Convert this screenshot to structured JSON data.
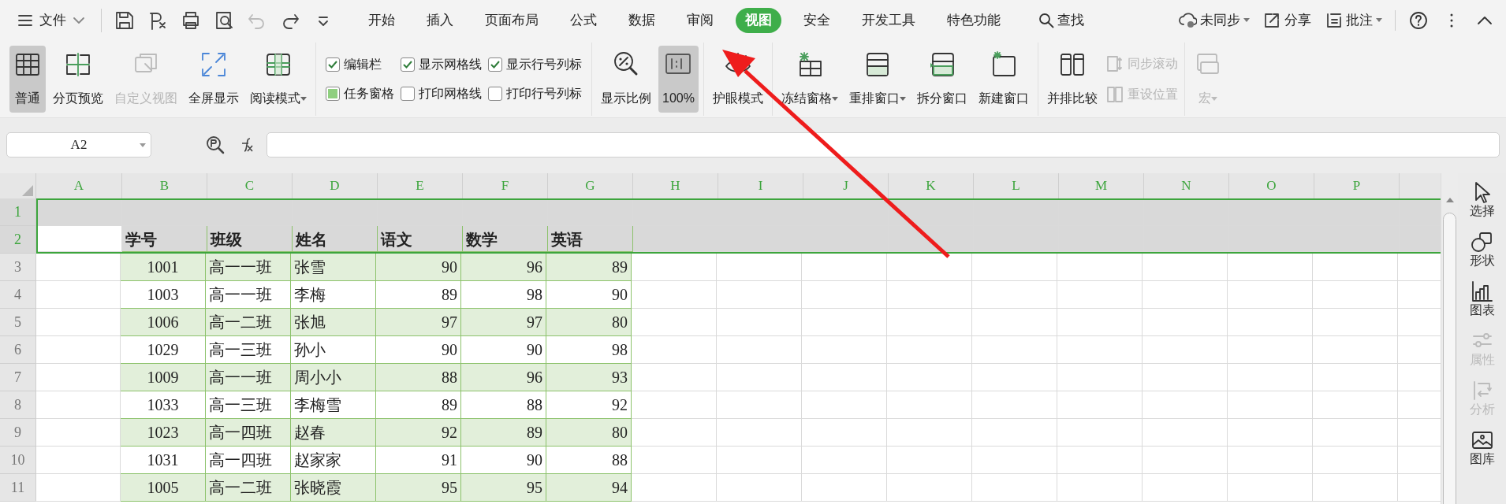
{
  "title_bar": {
    "file_menu": "文件",
    "tabs": [
      {
        "label": "开始",
        "selected": false
      },
      {
        "label": "插入",
        "selected": false
      },
      {
        "label": "页面布局",
        "selected": false
      },
      {
        "label": "公式",
        "selected": false
      },
      {
        "label": "数据",
        "selected": false
      },
      {
        "label": "审阅",
        "selected": false
      },
      {
        "label": "视图",
        "selected": true
      },
      {
        "label": "安全",
        "selected": false
      },
      {
        "label": "开发工具",
        "selected": false
      },
      {
        "label": "特色功能",
        "selected": false
      }
    ],
    "search": "查找",
    "actions": [
      {
        "label": "未同步",
        "dropdown": true
      },
      {
        "label": "分享"
      },
      {
        "label": "批注",
        "dropdown": true
      }
    ]
  },
  "ribbon": {
    "groups": [
      {
        "items": [
          {
            "kind": "large",
            "label": "普通",
            "selected": true,
            "disabled": false
          },
          {
            "kind": "large",
            "label": "分页预览",
            "selected": false,
            "disabled": false
          },
          {
            "kind": "large",
            "label": "自定义视图",
            "selected": false,
            "disabled": true
          },
          {
            "kind": "large",
            "label": "全屏显示",
            "selected": false,
            "disabled": false
          },
          {
            "kind": "large",
            "label": "阅读模式",
            "selected": false,
            "disabled": false,
            "dropdown": true
          }
        ]
      },
      {
        "items": [
          {
            "kind": "check",
            "label": "编辑栏",
            "checked": true
          },
          {
            "kind": "square_check",
            "label": "任务窗格",
            "checked": true
          },
          {
            "kind": "check",
            "label": "显示网格线",
            "checked": true
          },
          {
            "kind": "check",
            "label": "打印网格线",
            "checked": false
          },
          {
            "kind": "check",
            "label": "显示行号列标",
            "checked": true
          },
          {
            "kind": "check",
            "label": "打印行号列标",
            "checked": false
          }
        ]
      },
      {
        "items": [
          {
            "kind": "large",
            "label": "显示比例",
            "selected": false,
            "disabled": false
          },
          {
            "kind": "large",
            "label": "100%",
            "selected": true,
            "disabled": false
          }
        ]
      },
      {
        "items": [
          {
            "kind": "large",
            "label": "护眼模式",
            "selected": false,
            "disabled": false
          }
        ]
      },
      {
        "items": [
          {
            "kind": "large",
            "label": "冻结窗格",
            "selected": false,
            "disabled": false,
            "dropdown": true
          },
          {
            "kind": "large",
            "label": "重排窗口",
            "selected": false,
            "disabled": false,
            "dropdown": true
          },
          {
            "kind": "large",
            "label": "拆分窗口",
            "selected": false,
            "disabled": false
          },
          {
            "kind": "large",
            "label": "新建窗口",
            "selected": false,
            "disabled": false
          }
        ]
      },
      {
        "items": [
          {
            "kind": "large",
            "label": "并排比较",
            "selected": false,
            "disabled": false
          },
          {
            "kind": "small",
            "label": "同步滚动",
            "disabled": true
          },
          {
            "kind": "small",
            "label": "重设位置",
            "disabled": true
          }
        ]
      },
      {
        "items": [
          {
            "kind": "large",
            "label": "宏",
            "selected": false,
            "disabled": true,
            "dropdown": true
          }
        ]
      }
    ]
  },
  "formula_bar": {
    "name_box": "A2"
  },
  "sheet": {
    "columns": [
      {
        "label": "A",
        "selected": true
      },
      {
        "label": "B",
        "selected": true
      },
      {
        "label": "C",
        "selected": true
      },
      {
        "label": "D",
        "selected": true
      },
      {
        "label": "E",
        "selected": true
      },
      {
        "label": "F",
        "selected": true
      },
      {
        "label": "G",
        "selected": true
      },
      {
        "label": "H",
        "selected": true
      },
      {
        "label": "I",
        "selected": true
      },
      {
        "label": "J",
        "selected": true
      },
      {
        "label": "K",
        "selected": true
      },
      {
        "label": "L",
        "selected": true
      },
      {
        "label": "M",
        "selected": true
      },
      {
        "label": "N",
        "selected": true
      },
      {
        "label": "O",
        "selected": true
      },
      {
        "label": "P",
        "selected": true
      }
    ],
    "rows": [
      {
        "number": "1",
        "selected": true,
        "kind": "blank"
      },
      {
        "number": "2",
        "selected": true,
        "active": true,
        "kind": "header",
        "cells": [
          "学号",
          "班级",
          "姓名",
          "语文",
          "数学",
          "英语"
        ]
      },
      {
        "number": "3",
        "selected": false,
        "shaded": true,
        "kind": "data",
        "cells": [
          "1001",
          "高一一班",
          "张雪",
          "90",
          "96",
          "89"
        ]
      },
      {
        "number": "4",
        "selected": false,
        "shaded": false,
        "kind": "data",
        "cells": [
          "1003",
          "高一一班",
          "李梅",
          "89",
          "98",
          "90"
        ]
      },
      {
        "number": "5",
        "selected": false,
        "shaded": true,
        "kind": "data",
        "cells": [
          "1006",
          "高一二班",
          "张旭",
          "97",
          "97",
          "80"
        ]
      },
      {
        "number": "6",
        "selected": false,
        "shaded": false,
        "kind": "data",
        "cells": [
          "1029",
          "高一三班",
          "孙小",
          "90",
          "90",
          "98"
        ]
      },
      {
        "number": "7",
        "selected": false,
        "shaded": true,
        "kind": "data",
        "cells": [
          "1009",
          "高一一班",
          "周小小",
          "88",
          "96",
          "93"
        ]
      },
      {
        "number": "8",
        "selected": false,
        "shaded": false,
        "kind": "data",
        "cells": [
          "1033",
          "高一三班",
          "李梅雪",
          "89",
          "88",
          "92"
        ]
      },
      {
        "number": "9",
        "selected": false,
        "shaded": true,
        "kind": "data",
        "cells": [
          "1023",
          "高一四班",
          "赵春",
          "92",
          "89",
          "80"
        ]
      },
      {
        "number": "10",
        "selected": false,
        "shaded": false,
        "kind": "data",
        "cells": [
          "1031",
          "高一四班",
          "赵家家",
          "91",
          "90",
          "88"
        ]
      },
      {
        "number": "11",
        "selected": false,
        "shaded": true,
        "kind": "data",
        "cells": [
          "1005",
          "高一二班",
          "张晓霞",
          "95",
          "95",
          "94"
        ]
      }
    ]
  },
  "side_panel": [
    {
      "label": "选择",
      "disabled": false
    },
    {
      "label": "形状",
      "disabled": false
    },
    {
      "label": "图表",
      "disabled": false
    },
    {
      "label": "属性",
      "disabled": true
    },
    {
      "label": "分析",
      "disabled": true
    },
    {
      "label": "图库",
      "disabled": false
    }
  ]
}
